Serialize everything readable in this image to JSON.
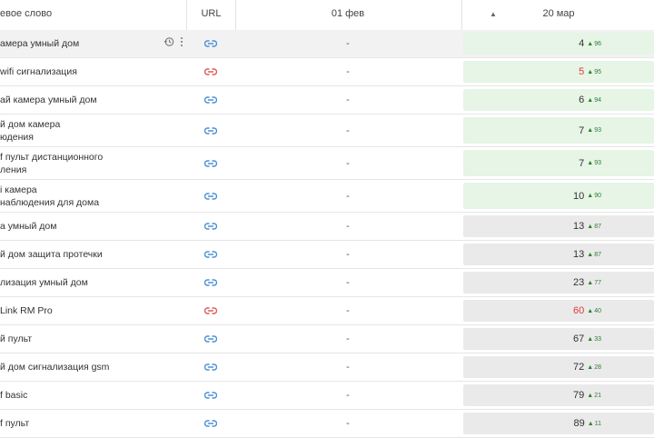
{
  "header": {
    "keyword": "евое слово",
    "url": "URL",
    "date1": "01 фев",
    "date2": "20 мар",
    "sort_indicator": "▲"
  },
  "colors": {
    "link_ok": "#4a8fd4",
    "link_broken": "#e05a5a",
    "cell_green": "#e6f5e6",
    "cell_gray": "#eaeaea",
    "up_green": "#2e7d32",
    "pos_red": "#e53935"
  },
  "rows": [
    {
      "keyword": "амера умный дом",
      "link": "ok",
      "d1": "-",
      "pos": "4",
      "chg": "96",
      "bg": "green",
      "red": false,
      "hl": true
    },
    {
      "keyword": "wifi сигнализация",
      "link": "broken",
      "d1": "-",
      "pos": "5",
      "chg": "95",
      "bg": "green",
      "red": true,
      "hl": false
    },
    {
      "keyword": "ай камера умный дом",
      "link": "ok",
      "d1": "-",
      "pos": "6",
      "chg": "94",
      "bg": "green",
      "red": false,
      "hl": false
    },
    {
      "keyword": "й дом камера\nюдения",
      "link": "ok",
      "d1": "-",
      "pos": "7",
      "chg": "93",
      "bg": "green",
      "red": false,
      "hl": false
    },
    {
      "keyword": "f пульт дистанционного\nления",
      "link": "ok",
      "d1": "-",
      "pos": "7",
      "chg": "93",
      "bg": "green",
      "red": false,
      "hl": false
    },
    {
      "keyword": "і камера\nнаблюдения для дома",
      "link": "ok",
      "d1": "-",
      "pos": "10",
      "chg": "90",
      "bg": "green",
      "red": false,
      "hl": false
    },
    {
      "keyword": "а умный дом",
      "link": "ok",
      "d1": "-",
      "pos": "13",
      "chg": "87",
      "bg": "gray",
      "red": false,
      "hl": false
    },
    {
      "keyword": "й дом защита протечки",
      "link": "ok",
      "d1": "-",
      "pos": "13",
      "chg": "87",
      "bg": "gray",
      "red": false,
      "hl": false
    },
    {
      "keyword": "лизация умный дом",
      "link": "ok",
      "d1": "-",
      "pos": "23",
      "chg": "77",
      "bg": "gray",
      "red": false,
      "hl": false
    },
    {
      "keyword": "Link RM Pro",
      "link": "broken",
      "d1": "-",
      "pos": "60",
      "chg": "40",
      "bg": "gray",
      "red": true,
      "hl": false
    },
    {
      "keyword": "й пульт",
      "link": "ok",
      "d1": "-",
      "pos": "67",
      "chg": "33",
      "bg": "gray",
      "red": false,
      "hl": false
    },
    {
      "keyword": "й дом сигнализация gsm",
      "link": "ok",
      "d1": "-",
      "pos": "72",
      "chg": "28",
      "bg": "gray",
      "red": false,
      "hl": false
    },
    {
      "keyword": "f basic",
      "link": "ok",
      "d1": "-",
      "pos": "79",
      "chg": "21",
      "bg": "gray",
      "red": false,
      "hl": false
    },
    {
      "keyword": "f пульт",
      "link": "ok",
      "d1": "-",
      "pos": "89",
      "chg": "11",
      "bg": "gray",
      "red": false,
      "hl": false
    }
  ]
}
